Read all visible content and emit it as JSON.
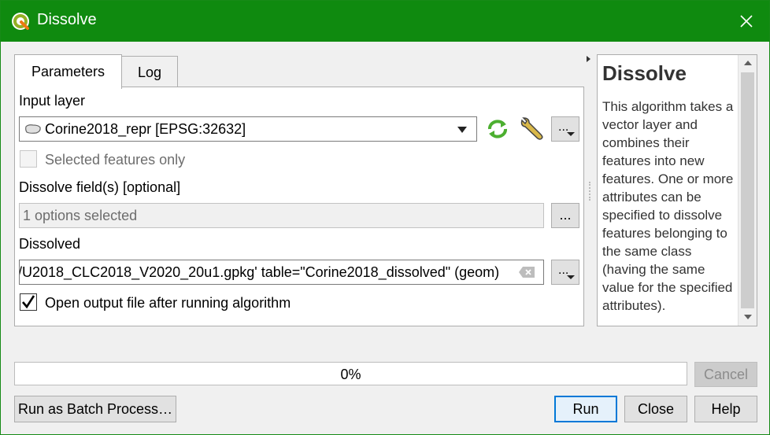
{
  "window": {
    "title": "Dissolve",
    "close_icon": "close-icon",
    "colors": {
      "titlebar": "#0f8a0f",
      "progress_fill": "#06b025"
    }
  },
  "tabs": [
    {
      "label": "Parameters",
      "active": true
    },
    {
      "label": "Log",
      "active": false
    }
  ],
  "params": {
    "input_layer_label": "Input layer",
    "input_layer_value": "Corine2018_repr [EPSG:32632]",
    "selected_only_label": "Selected features only",
    "selected_only_checked": false,
    "dissolve_fields_label": "Dissolve field(s) [optional]",
    "dissolve_fields_value": "1 options selected",
    "dissolved_label": "Dissolved",
    "dissolved_value": "/U2018_CLC2018_V2020_20u1.gpkg' table=\"Corine2018_dissolved\" (geom)",
    "open_output_label": "Open output file after running algorithm",
    "open_output_checked": true,
    "dots": "..."
  },
  "help": {
    "title": "Dissolve",
    "body": "This algorithm takes a vector layer and combines their features into new features. One or more attributes can be specified to dissolve features belonging to the same class (having the same value for the specified attributes)."
  },
  "progress": {
    "value": 0,
    "label": "0%"
  },
  "buttons": {
    "cancel": "Cancel",
    "batch": "Run as Batch Process…",
    "run": "Run",
    "close": "Close",
    "help": "Help"
  }
}
